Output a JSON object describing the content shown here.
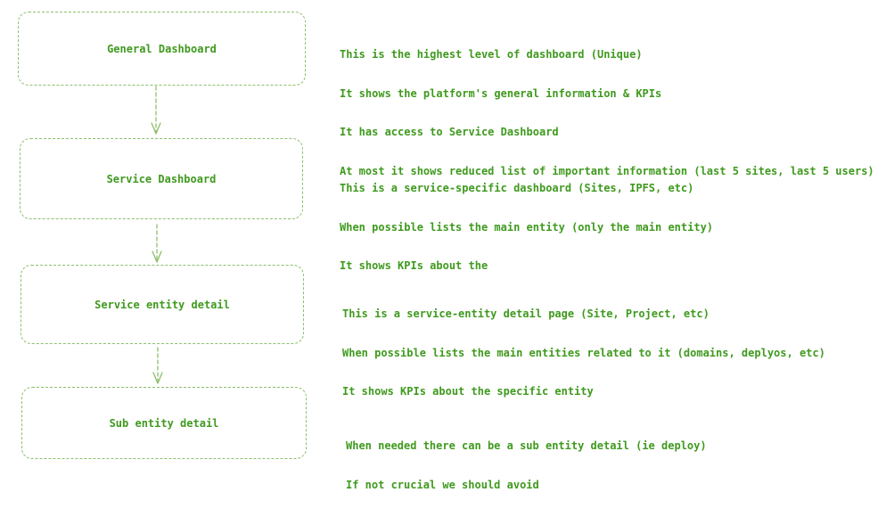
{
  "nodes": [
    {
      "id": "general-dashboard",
      "label": "General Dashboard",
      "notes": [
        "This is the highest level of dashboard (Unique)",
        "It shows the platform's general information & KPIs",
        "It has access to Service Dashboard",
        "At most it shows reduced list of important information (last 5 sites, last 5 users)"
      ]
    },
    {
      "id": "service-dashboard",
      "label": "Service Dashboard",
      "notes": [
        "This is a service-specific dashboard (Sites, IPFS, etc)",
        "When possible lists the main entity (only the main entity)",
        "It shows KPIs about the"
      ]
    },
    {
      "id": "service-entity-detail",
      "label": "Service entity detail",
      "notes": [
        "This is a service-entity detail page (Site, Project, etc)",
        "When possible lists the main entities related to it (domains, deplyos, etc)",
        "It shows KPIs about the specific entity"
      ]
    },
    {
      "id": "sub-entity-detail",
      "label": "Sub entity detail",
      "notes": [
        "When needed there can be a sub entity detail (ie deploy)",
        "If not crucial we should avoid"
      ]
    }
  ],
  "colors": {
    "text": "#3f9a1e",
    "stroke": "#8cbf6a",
    "background": "#ffffff"
  }
}
